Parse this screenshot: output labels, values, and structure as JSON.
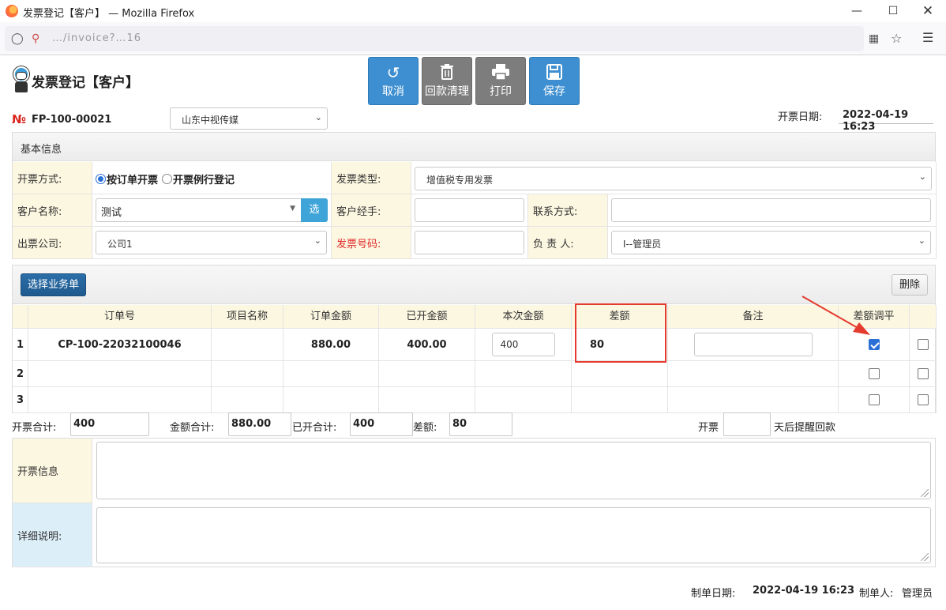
{
  "browser": {
    "window_title": "发票登记【客户】 — Mozilla Firefox",
    "url": "…/invoice?…16"
  },
  "header": {
    "page_title": "发票登记【客户】",
    "actions": {
      "cancel": "取消",
      "clear_payment": "回款清理",
      "print": "打印",
      "save": "保存"
    },
    "number_symbol": "№",
    "invoice_no": "FP-100-00021",
    "company_select": "山东中视传媒",
    "date_label": "开票日期:",
    "date_value": "2022-04-19 16:23"
  },
  "basic": {
    "section_title": "基本信息",
    "method_label": "开票方式:",
    "method_options": [
      "按订单开票",
      "开票例行登记"
    ],
    "type_label": "发票类型:",
    "type_value": "增值税专用发票",
    "customer_label": "客户名称:",
    "customer_value": "测试",
    "select_button": "选",
    "handler_label": "客户经手:",
    "handler_value": "",
    "contact_label": "联系方式:",
    "contact_value": "",
    "issuer_label": "出票公司:",
    "issuer_value": "公司1",
    "invoice_number_label": "发票号码:",
    "invoice_number_value": "",
    "owner_label": "负 责 人:",
    "owner_value": "I--管理员"
  },
  "orders": {
    "select_button": "选择业务单",
    "delete_button": "删除",
    "columns": [
      "订单号",
      "项目名称",
      "订单金额",
      "已开金额",
      "本次金额",
      "差额",
      "备注",
      "差额调平"
    ],
    "rows": [
      {
        "index": "1",
        "order_no": "CP-100-22032100046",
        "project": "",
        "order_amount": "880.00",
        "invoiced": "400.00",
        "this_amount": "400",
        "diff": "80",
        "note": "",
        "adjust": true,
        "selected": false
      },
      {
        "index": "2",
        "order_no": "",
        "project": "",
        "order_amount": "",
        "invoiced": "",
        "this_amount": "",
        "diff": "",
        "note": "",
        "adjust": false,
        "selected": false
      },
      {
        "index": "3",
        "order_no": "",
        "project": "",
        "order_amount": "",
        "invoiced": "",
        "this_amount": "",
        "diff": "",
        "note": "",
        "adjust": false,
        "selected": false
      }
    ]
  },
  "totals": {
    "invoice_total_label": "开票合计:",
    "invoice_total": "400",
    "amount_total_label": "金额合计:",
    "amount_total": "880.00",
    "invoiced_total_label": "已开合计:",
    "invoiced_total": "400",
    "diff_label": "差额:",
    "diff_value": "80",
    "remind_prefix": "开票",
    "remind_days": "",
    "remind_suffix": "天后提醒回款"
  },
  "notes": {
    "invoice_info_label": "开票信息",
    "invoice_info": "",
    "detail_label": "详细说明:",
    "detail": ""
  },
  "footer": {
    "made_date_label": "制单日期:",
    "made_date": "2022-04-19 16:23",
    "maker_label": "制单人:",
    "maker": "管理员"
  },
  "colors": {
    "primary_blue": "#3d8fd1",
    "label_bg": "#fcf7e1",
    "highlight_red": "#e02b2b"
  }
}
